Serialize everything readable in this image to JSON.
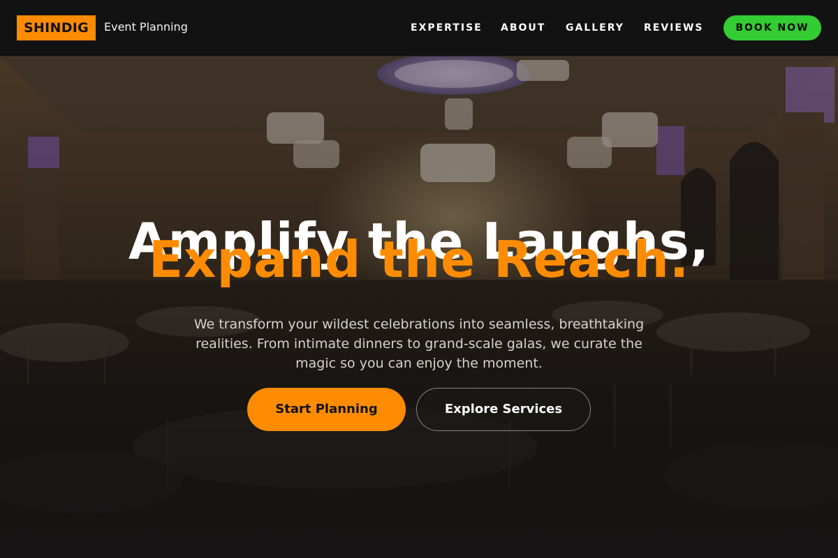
{
  "brand": {
    "logo_text": "SHINDIG",
    "subtitle": "Event Planning"
  },
  "nav": {
    "items": [
      "EXPERTISE",
      "ABOUT",
      "GALLERY",
      "REVIEWS"
    ],
    "cta_label": "BOOK NOW"
  },
  "hero": {
    "headline_line1": "Amplify the Laughs,",
    "headline_line2": "Expand the Reach.",
    "tagline": "We transform your wildest celebrations into seamless, breathtaking realities. From intimate dinners to grand-scale galas, we curate the magic so you can enjoy the moment.",
    "primary_button": "Start Planning",
    "secondary_button": "Explore Services",
    "background_image": "ballroom-with-chandeliers-and-round-tables"
  },
  "colors": {
    "accent": "#ff8c00",
    "cta_green": "#33cc33",
    "header_bg": "#121212"
  }
}
